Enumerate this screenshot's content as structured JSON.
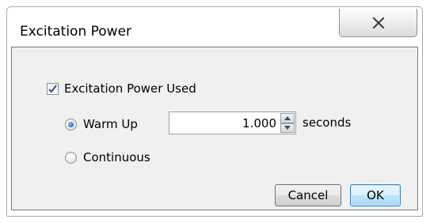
{
  "window": {
    "title": "Excitation Power",
    "close_icon": "close-x-icon"
  },
  "form": {
    "checkbox": {
      "label": "Excitation Power Used",
      "checked": true
    },
    "radios": [
      {
        "label": "Warm Up",
        "selected": true
      },
      {
        "label": "Continuous",
        "selected": false
      }
    ],
    "warmup": {
      "value": "1.000",
      "unit": "seconds"
    }
  },
  "buttons": {
    "cancel_label": "Cancel",
    "ok_label": "OK"
  }
}
